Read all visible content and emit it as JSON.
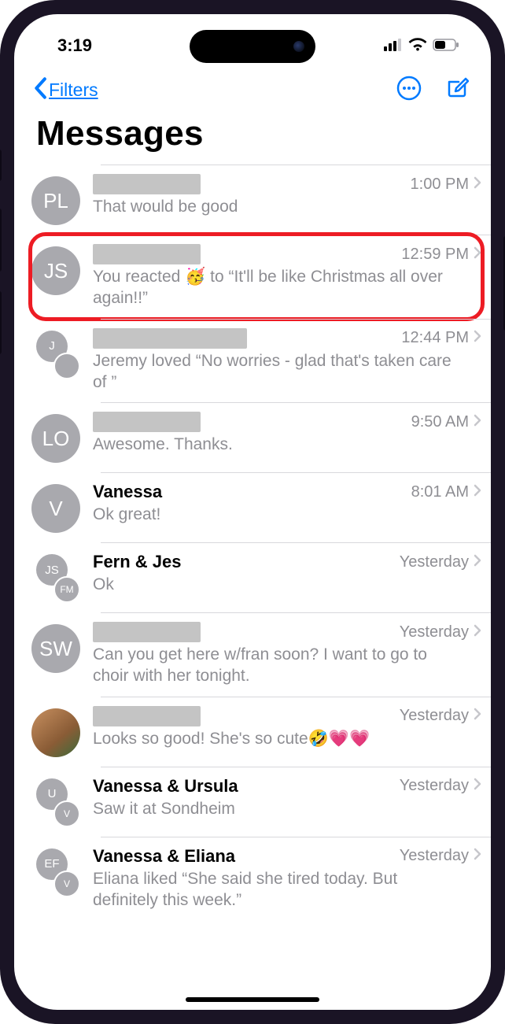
{
  "status": {
    "time": "3:19"
  },
  "nav": {
    "back_label": "Filters"
  },
  "page": {
    "title": "Messages"
  },
  "conversations": [
    {
      "initials": "PL",
      "name": "████████",
      "name_redacted": true,
      "time": "1:00 PM",
      "preview": "That would be good",
      "avatar_type": "initials",
      "highlighted": false
    },
    {
      "initials": "JS",
      "name": "████████",
      "name_redacted": true,
      "time": "12:59 PM",
      "preview": "You reacted 🥳 to “It'll be like Christmas all over again!!”",
      "avatar_type": "initials",
      "highlighted": true
    },
    {
      "initials": "J",
      "name": "████ & ██████",
      "name_redacted": true,
      "time": "12:44 PM",
      "preview": "Jeremy loved “No worries - glad that's taken care of ”",
      "avatar_type": "group",
      "group_initials": [
        "J",
        ""
      ],
      "highlighted": false
    },
    {
      "initials": "LO",
      "name": "████████",
      "name_redacted": true,
      "time": "9:50 AM",
      "preview": "Awesome. Thanks.",
      "avatar_type": "initials",
      "highlighted": false
    },
    {
      "initials": "V",
      "name": "Vanessa",
      "name_redacted": false,
      "time": "8:01 AM",
      "preview": "Ok great!",
      "avatar_type": "initials",
      "highlighted": false
    },
    {
      "initials": "JS",
      "name": "Fern & Jes",
      "name_redacted": false,
      "time": "Yesterday",
      "preview": "Ok",
      "avatar_type": "group",
      "group_initials": [
        "JS",
        "FM"
      ],
      "highlighted": false
    },
    {
      "initials": "SW",
      "name": "████████",
      "name_redacted": true,
      "time": "Yesterday",
      "preview": "Can you get here w/fran soon? I want to go to choir with her tonight.",
      "avatar_type": "initials",
      "highlighted": false
    },
    {
      "initials": "",
      "name": "████████",
      "name_redacted": true,
      "time": "Yesterday",
      "preview": "Looks so good! She's so cute🤣💗💗",
      "avatar_type": "photo",
      "highlighted": false
    },
    {
      "initials": "U",
      "name": "Vanessa & Ursula",
      "name_redacted": false,
      "time": "Yesterday",
      "preview": "Saw it at Sondheim",
      "avatar_type": "group",
      "group_initials": [
        "U",
        "V"
      ],
      "highlighted": false
    },
    {
      "initials": "EF",
      "name": "Vanessa & Eliana",
      "name_redacted": false,
      "time": "Yesterday",
      "preview": "Eliana liked “She said she tired today. But definitely this week.”",
      "avatar_type": "group",
      "group_initials": [
        "EF",
        "V"
      ],
      "highlighted": false
    }
  ]
}
